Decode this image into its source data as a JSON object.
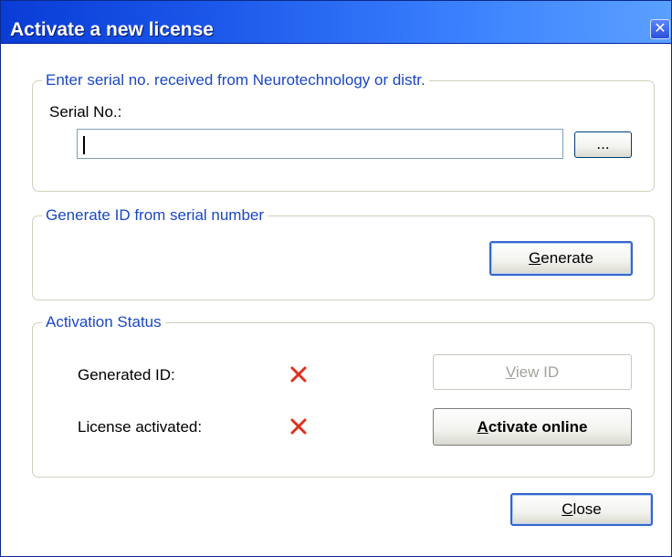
{
  "window": {
    "title": "Activate a new license",
    "close_glyph": "✕"
  },
  "serial_group": {
    "legend": "Enter serial no. received from Neurotechnology or distr.",
    "serial_label": "Serial No.:",
    "serial_value": "",
    "browse_label": "..."
  },
  "generate_group": {
    "legend": "Generate ID from serial number",
    "generate_button": {
      "mnemonic": "G",
      "rest": "enerate"
    }
  },
  "status_group": {
    "legend": "Activation Status",
    "generated_id_label": "Generated ID:",
    "license_activated_label": "License activated:",
    "generated_id_status_icon": "red-x-icon",
    "license_activated_status_icon": "red-x-icon",
    "view_id_button": {
      "mnemonic": "V",
      "rest": "iew ID",
      "enabled": false
    },
    "activate_online_button": {
      "mnemonic": "A",
      "rest": "ctivate online"
    }
  },
  "footer": {
    "close_button": {
      "mnemonic": "C",
      "rest": "lose"
    }
  },
  "colors": {
    "titlebar": "#0a3cd6",
    "legend_text": "#1a48c4",
    "status_x": "#e0301e"
  }
}
